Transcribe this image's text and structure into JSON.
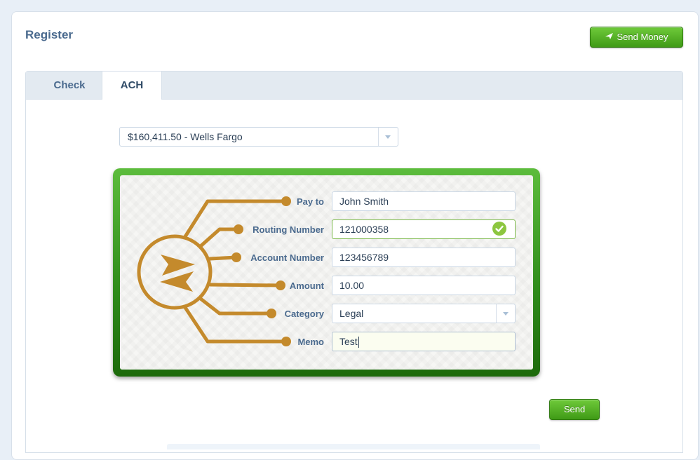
{
  "page": {
    "title": "Register"
  },
  "header": {
    "send_money_label": "Send Money",
    "send_money_icon": "paper-plane-icon"
  },
  "tabs": [
    {
      "label": "Check",
      "active": false
    },
    {
      "label": "ACH",
      "active": true
    }
  ],
  "account": {
    "selected": "$160,411.50 -  Wells Fargo"
  },
  "form": {
    "pay_to": {
      "label": "Pay to",
      "value": "John Smith"
    },
    "routing_number": {
      "label": "Routing Number",
      "value": "121000358",
      "valid": true
    },
    "account_number": {
      "label": "Account Number",
      "value": "123456789"
    },
    "amount": {
      "label": "Amount",
      "value": "10.00"
    },
    "category": {
      "label": "Category",
      "value": "Legal"
    },
    "memo": {
      "label": "Memo",
      "value": "Test"
    }
  },
  "actions": {
    "send_label": "Send"
  },
  "colors": {
    "accent_green": "#3f9a16",
    "emblem_gold": "#c48a2c",
    "heading_blue": "#4a6a8e",
    "valid_green": "#8cc63f"
  }
}
